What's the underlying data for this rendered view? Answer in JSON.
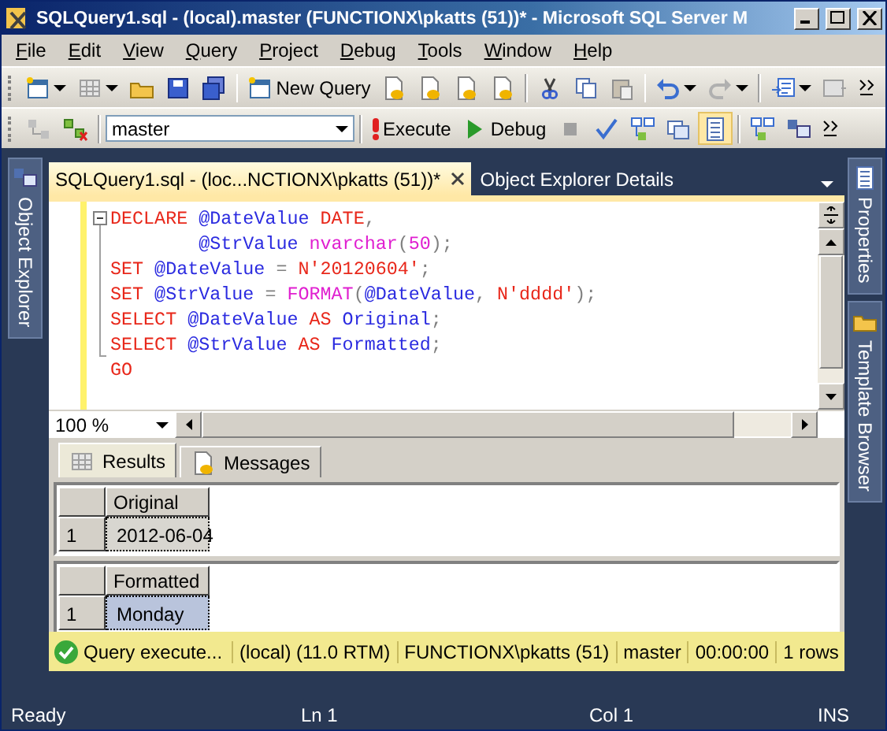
{
  "window": {
    "title": "SQLQuery1.sql - (local).master (FUNCTIONX\\pkatts (51))* - Microsoft SQL Server M"
  },
  "menu": [
    "File",
    "Edit",
    "View",
    "Query",
    "Project",
    "Debug",
    "Tools",
    "Window",
    "Help"
  ],
  "toolbar": {
    "new_query": "New Query",
    "database": "master",
    "execute": "Execute",
    "debug": "Debug"
  },
  "side_panels": {
    "left": [
      {
        "label": "Object Explorer"
      }
    ],
    "right": [
      {
        "label": "Properties"
      },
      {
        "label": "Template Browser"
      }
    ]
  },
  "document_tabs": [
    {
      "label": "SQLQuery1.sql - (loc...NCTIONX\\pkatts (51))*",
      "selected": true
    },
    {
      "label": "Object Explorer Details",
      "selected": false
    }
  ],
  "editor": {
    "zoom": "100 %",
    "lines": [
      [
        {
          "t": "DECLARE",
          "kind": "keyword"
        },
        {
          "t": " @DateValue",
          "kind": "identifier"
        },
        {
          "t": " DATE",
          "kind": "keyword"
        },
        {
          "t": ",",
          "kind": "operator"
        }
      ],
      [
        {
          "t": "        @StrValue",
          "kind": "identifier"
        },
        {
          "t": " nvarchar",
          "kind": "function"
        },
        {
          "t": "(",
          "kind": "operator"
        },
        {
          "t": "50",
          "kind": "function"
        },
        {
          "t": ");",
          "kind": "operator"
        }
      ],
      [
        {
          "t": "SET",
          "kind": "keyword"
        },
        {
          "t": " @DateValue",
          "kind": "identifier"
        },
        {
          "t": " =",
          "kind": "operator"
        },
        {
          "t": " N'20120604'",
          "kind": "string"
        },
        {
          "t": ";",
          "kind": "operator"
        }
      ],
      [
        {
          "t": "SET",
          "kind": "keyword"
        },
        {
          "t": " @StrValue",
          "kind": "identifier"
        },
        {
          "t": " =",
          "kind": "operator"
        },
        {
          "t": " FORMAT",
          "kind": "function"
        },
        {
          "t": "(",
          "kind": "operator"
        },
        {
          "t": "@DateValue",
          "kind": "identifier"
        },
        {
          "t": ",",
          "kind": "operator"
        },
        {
          "t": " N'dddd'",
          "kind": "string"
        },
        {
          "t": ");",
          "kind": "operator"
        }
      ],
      [
        {
          "t": "SELECT",
          "kind": "keyword"
        },
        {
          "t": " @DateValue",
          "kind": "identifier"
        },
        {
          "t": " AS",
          "kind": "keyword"
        },
        {
          "t": " Original",
          "kind": "identifier"
        },
        {
          "t": ";",
          "kind": "operator"
        }
      ],
      [
        {
          "t": "SELECT",
          "kind": "keyword"
        },
        {
          "t": " @StrValue",
          "kind": "identifier"
        },
        {
          "t": " AS",
          "kind": "keyword"
        },
        {
          "t": " Formatted",
          "kind": "identifier"
        },
        {
          "t": ";",
          "kind": "operator"
        }
      ],
      [
        {
          "t": "GO",
          "kind": "keyword"
        }
      ]
    ]
  },
  "results": {
    "tabs": [
      {
        "label": "Results",
        "selected": true
      },
      {
        "label": "Messages",
        "selected": false
      }
    ],
    "grids": [
      {
        "columns": [
          "Original"
        ],
        "rows": [
          {
            "number": "1",
            "cells": [
              {
                "text": "2012-06-04",
                "selected": false
              }
            ]
          }
        ]
      },
      {
        "columns": [
          "Formatted"
        ],
        "rows": [
          {
            "number": "1",
            "cells": [
              {
                "text": "Monday",
                "selected": true
              }
            ]
          }
        ]
      }
    ]
  },
  "query_status": {
    "message": "Query execute...",
    "fields": [
      "(local) (11.0 RTM)",
      "FUNCTIONX\\pkatts (51)",
      "master",
      "00:00:00",
      "1 rows"
    ]
  },
  "status_bar": [
    "Ready",
    "Ln 1",
    "Col 1",
    "INS"
  ]
}
